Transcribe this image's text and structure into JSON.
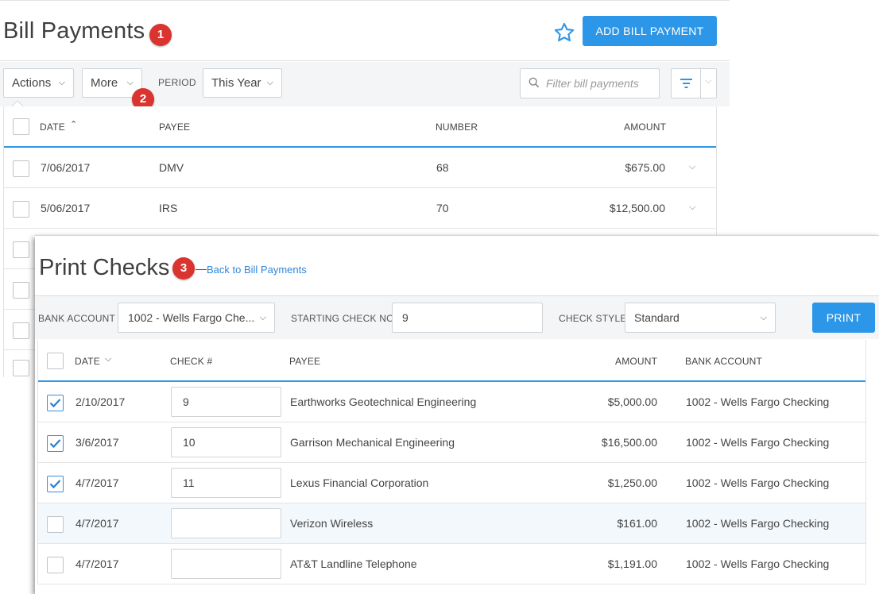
{
  "bill_payments": {
    "title": "Bill Payments",
    "badge": "1",
    "add_button": "ADD BILL PAYMENT",
    "toolbar": {
      "actions_label": "Actions",
      "more_label": "More",
      "more_badge": "2",
      "period_label": "PERIOD",
      "period_value": "This Year",
      "search_placeholder": "Filter bill payments"
    },
    "columns": {
      "date": "DATE",
      "payee": "PAYEE",
      "number": "NUMBER",
      "amount": "AMOUNT"
    },
    "rows": [
      {
        "date": "7/06/2017",
        "payee": "DMV",
        "number": "68",
        "amount": "$675.00"
      },
      {
        "date": "5/06/2017",
        "payee": "IRS",
        "number": "70",
        "amount": "$12,500.00"
      }
    ]
  },
  "print_checks": {
    "title": "Print Checks",
    "badge": "3",
    "back_link": "Back to Bill Payments",
    "toolbar": {
      "bank_account_label": "BANK ACCOUNT",
      "bank_account_value": "1002 - Wells Fargo Che...",
      "starting_check_label": "STARTING CHECK NO",
      "starting_check_value": "9",
      "check_style_label": "CHECK STYLE",
      "check_style_value": "Standard",
      "print_button": "PRINT"
    },
    "columns": {
      "date": "DATE",
      "check": "CHECK #",
      "payee": "PAYEE",
      "amount": "AMOUNT",
      "bank_account": "BANK ACCOUNT"
    },
    "rows": [
      {
        "checked": true,
        "date": "2/10/2017",
        "check": "9",
        "payee": "Earthworks Geotechnical Engineering",
        "amount": "$5,000.00",
        "bank_account": "1002 - Wells Fargo Checking"
      },
      {
        "checked": true,
        "date": "3/6/2017",
        "check": "10",
        "payee": "Garrison Mechanical Engineering",
        "amount": "$16,500.00",
        "bank_account": "1002 - Wells Fargo Checking"
      },
      {
        "checked": true,
        "date": "4/7/2017",
        "check": "11",
        "payee": "Lexus Financial Corporation",
        "amount": "$1,250.00",
        "bank_account": "1002 - Wells Fargo Checking"
      },
      {
        "checked": false,
        "date": "4/7/2017",
        "check": "",
        "payee": "Verizon Wireless",
        "amount": "$161.00",
        "bank_account": "1002 - Wells Fargo Checking"
      },
      {
        "checked": false,
        "date": "4/7/2017",
        "check": "",
        "payee": "AT&T Landline Telephone",
        "amount": "$1,191.00",
        "bank_account": "1002 - Wells Fargo Checking"
      }
    ]
  },
  "colors": {
    "accent": "#2c97e8",
    "badge": "#d9342f",
    "link": "#2f87d8"
  },
  "icons": [
    "star-icon",
    "chevron-down-icon",
    "search-icon",
    "filter-icon",
    "sort-asc-icon",
    "sort-desc-icon",
    "checkmark-icon"
  ]
}
